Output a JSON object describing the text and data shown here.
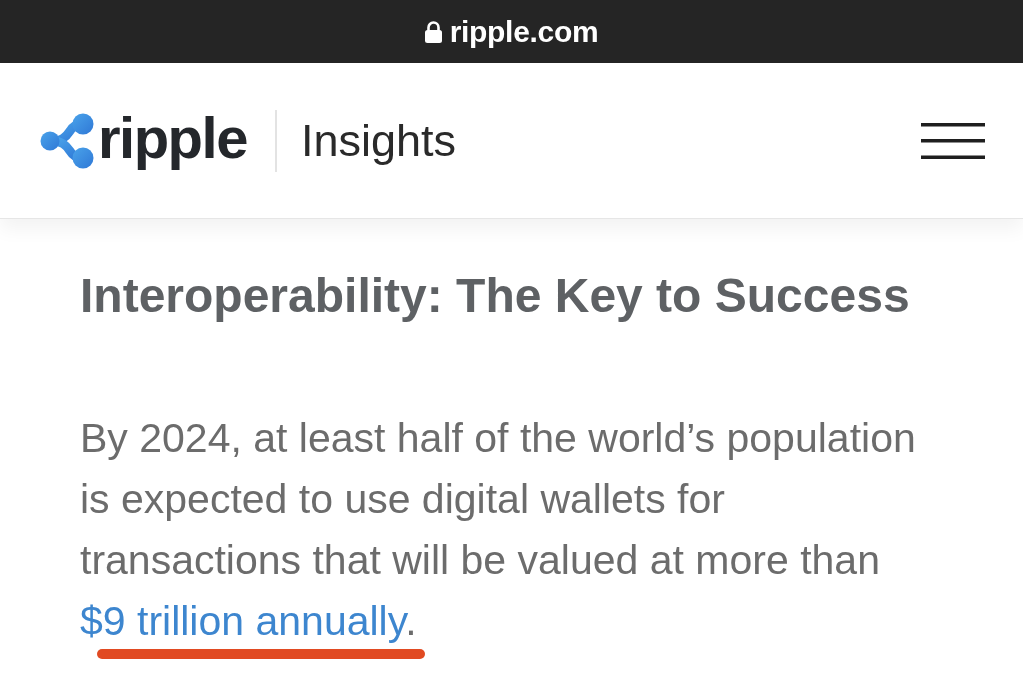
{
  "address_bar": {
    "url": "ripple.com",
    "secure": true
  },
  "header": {
    "logo_text": "ripple",
    "section": "Insights"
  },
  "article": {
    "heading": "Interoperability: The Key to Success",
    "paragraph": {
      "text": "By 2024, at least half of the world’s population is expected to use digital wallets for transactions that will be valued at more than ",
      "link": {
        "text": "$9 trillion annually",
        "highlighted": true
      },
      "end": "."
    }
  }
}
